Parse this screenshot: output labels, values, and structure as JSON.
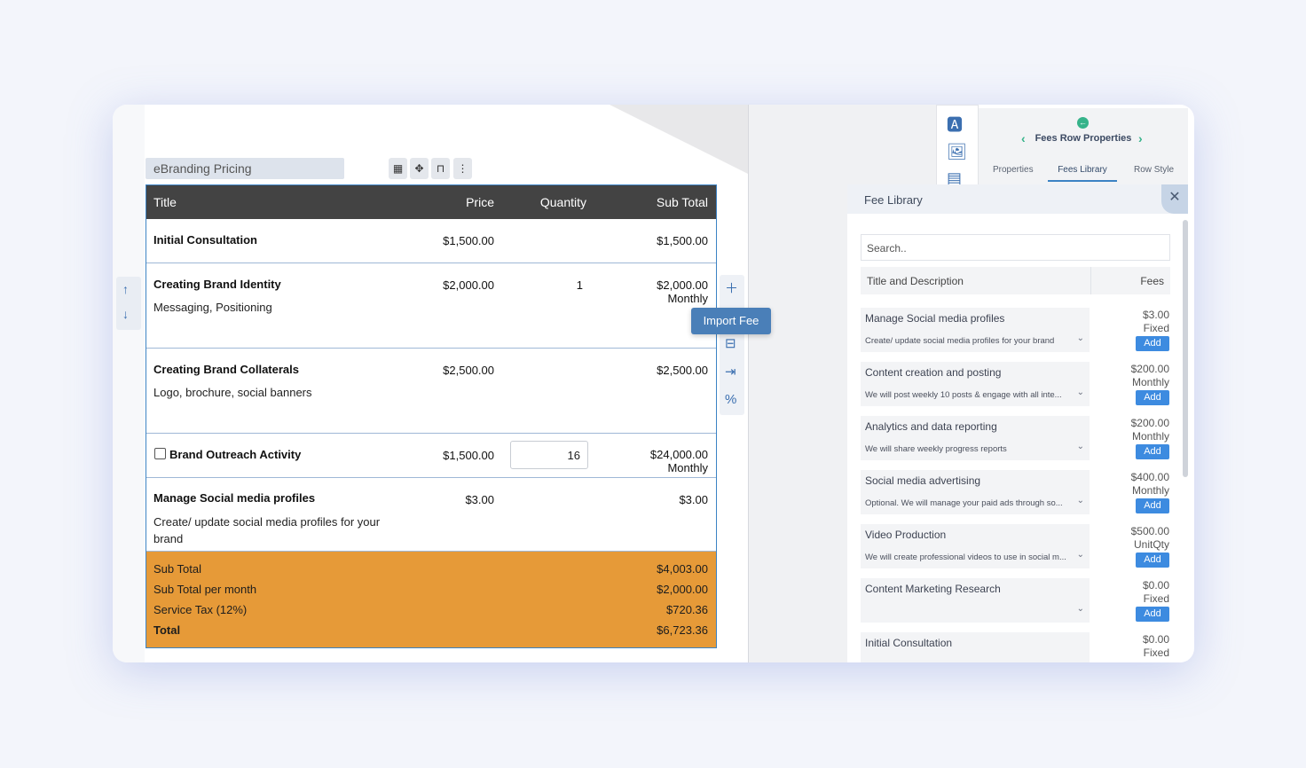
{
  "document": {
    "section_title": "eBranding Pricing",
    "toolbar_icons": [
      "table-icon",
      "move-icon",
      "lock-icon",
      "more-vertical-icon"
    ],
    "table": {
      "headers": {
        "title": "Title",
        "price": "Price",
        "quantity": "Quantity",
        "subtotal": "Sub Total"
      },
      "rows": [
        {
          "title": "Initial Consultation",
          "description": "",
          "price": "$1,500.00",
          "quantity": "",
          "subtotal": "$1,500.00",
          "period": ""
        },
        {
          "title": "Creating Brand Identity",
          "description": "Messaging, Positioning",
          "price": "$2,000.00",
          "quantity": "1",
          "subtotal": "$2,000.00",
          "period": "Monthly"
        },
        {
          "title": "Creating Brand Collaterals",
          "description": "Logo, brochure, social banners",
          "price": "$2,500.00",
          "quantity": "",
          "subtotal": "$2,500.00",
          "period": ""
        },
        {
          "title": "Brand Outreach Activity",
          "description": "",
          "price": "$1,500.00",
          "quantity": "16",
          "subtotal": "$24,000.00",
          "period": "Monthly"
        },
        {
          "title": "Manage  Social media profiles",
          "description": "Create/ update social media profiles for your brand",
          "price": "$3.00",
          "quantity": "",
          "subtotal": "$3.00",
          "period": ""
        }
      ],
      "totals": [
        {
          "label": "Sub Total",
          "value": "$4,003.00"
        },
        {
          "label": "Sub Total per month",
          "value": "$2,000.00"
        },
        {
          "label": "Service Tax (12%)",
          "value": "$720.36"
        },
        {
          "label": "Total",
          "value": "$6,723.36"
        }
      ]
    },
    "tooltip": "Import Fee",
    "accent_color": "#e69a38"
  },
  "panel": {
    "title": "Fees Row Properties",
    "tabs": [
      "Properties",
      "Fees Library",
      "Row Style"
    ],
    "active_tab": "Fees Library",
    "library": {
      "title": "Fee Library",
      "search_placeholder": "Search..",
      "col_title": "Title and Description",
      "col_fees": "Fees",
      "add_label": "Add",
      "items": [
        {
          "name": "Manage Social media profiles",
          "desc": "Create/ update social media profiles for your brand",
          "price": "$3.00",
          "period": "Fixed"
        },
        {
          "name": "Content creation and posting",
          "desc": "We will post weekly 10 posts & engage with all inte...",
          "price": "$200.00",
          "period": "Monthly"
        },
        {
          "name": "Analytics and data reporting",
          "desc": "We will share weekly progress reports",
          "price": "$200.00",
          "period": "Monthly"
        },
        {
          "name": "Social media advertising",
          "desc": "Optional. We will manage your paid ads through so...",
          "price": "$400.00",
          "period": "Monthly"
        },
        {
          "name": "Video Production",
          "desc": "We will create professional videos to use in social m...",
          "price": "$500.00",
          "period": "UnitQty"
        },
        {
          "name": "Content Marketing Research",
          "desc": "",
          "price": "$0.00",
          "period": "Fixed"
        },
        {
          "name": "Initial Consultation",
          "desc": "",
          "price": "$0.00",
          "period": "Fixed"
        }
      ]
    }
  }
}
